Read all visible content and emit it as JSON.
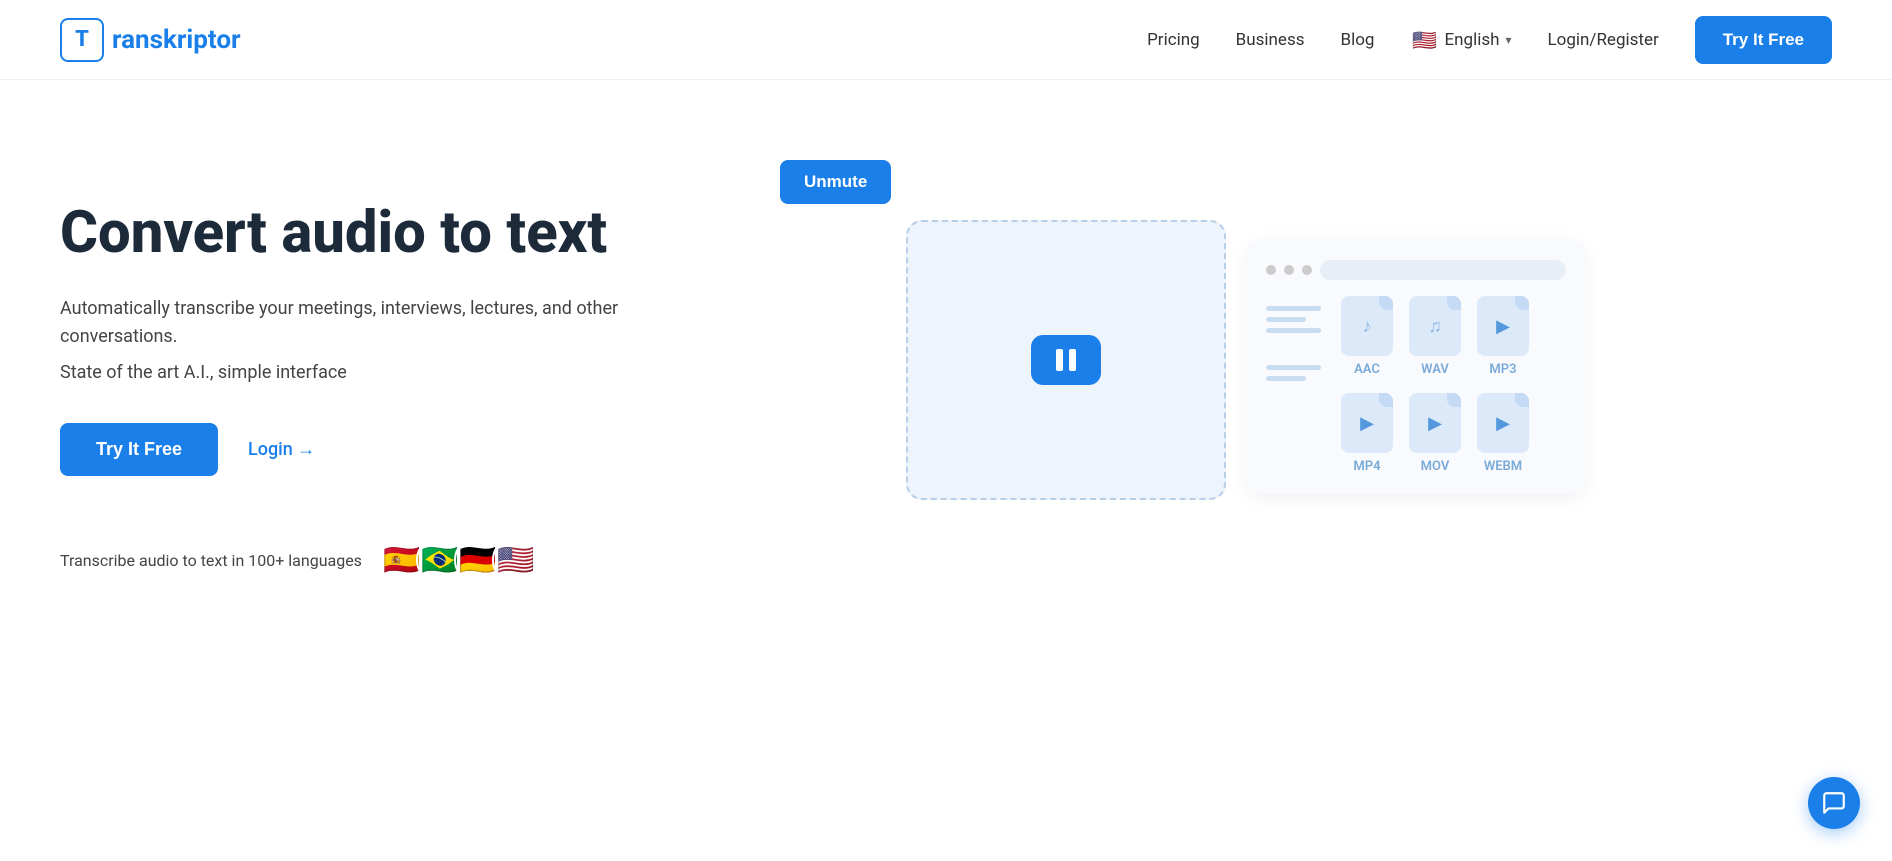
{
  "logo": {
    "letter": "T",
    "name": "ranskriptor"
  },
  "nav": {
    "links": [
      {
        "id": "pricing",
        "label": "Pricing"
      },
      {
        "id": "business",
        "label": "Business"
      },
      {
        "id": "blog",
        "label": "Blog"
      }
    ],
    "language": {
      "flag": "🇺🇸",
      "label": "English"
    },
    "login_label": "Login/Register",
    "try_btn": "Try It Free"
  },
  "hero": {
    "title": "Convert audio to text",
    "subtitle": "Automatically transcribe your meetings, interviews, lectures, and other conversations.",
    "sub2": "State of the art A.I., simple interface",
    "try_btn": "Try It Free",
    "login_label": "Login →",
    "languages_text": "Transcribe audio to text in 100+ languages",
    "flags": [
      "🇪🇸",
      "🇧🇷",
      "🇩🇪",
      "🇺🇸"
    ]
  },
  "player": {
    "unmute_label": "Unmute"
  },
  "formats": {
    "items": [
      {
        "label": "AAC",
        "type": "note"
      },
      {
        "label": "WAV",
        "type": "note"
      },
      {
        "label": "MP3",
        "type": "play"
      },
      {
        "label": "MP4",
        "type": "play"
      },
      {
        "label": "MOV",
        "type": "play"
      },
      {
        "label": "WEBM",
        "type": "play"
      }
    ]
  },
  "chat": {
    "icon_label": "chat-icon"
  }
}
